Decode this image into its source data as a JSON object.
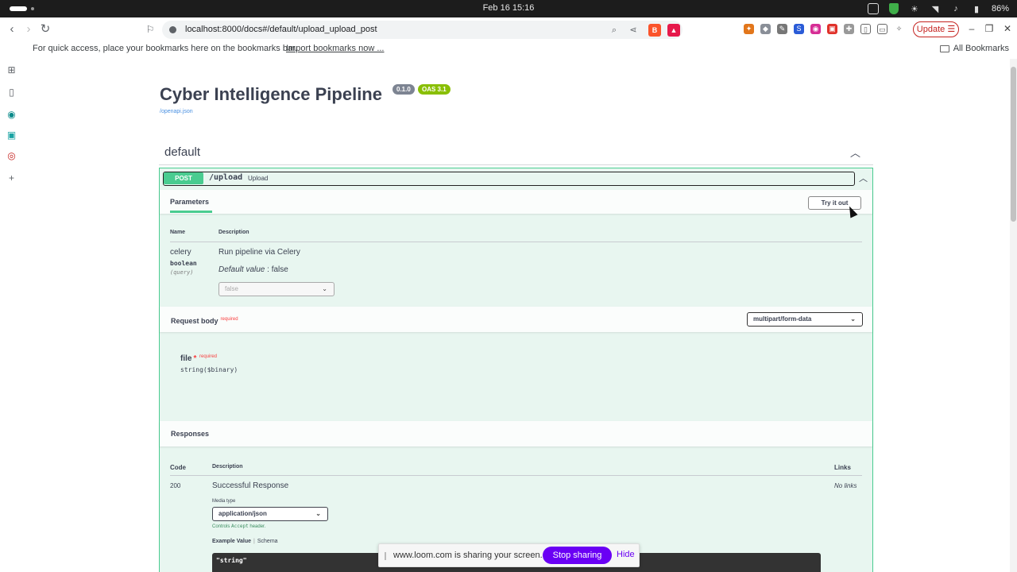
{
  "os": {
    "clock": "Feb 16  15:16",
    "battery": "86%"
  },
  "browser": {
    "url": "localhost:8000/docs#/default/upload_upload_post",
    "update_label": "Update",
    "update_icon": "☰",
    "bookmarks_hint": "For quick access, place your bookmarks here on the bookmarks bar.",
    "import_bookmarks": "Import bookmarks now ...",
    "all_bookmarks": "All Bookmarks"
  },
  "api": {
    "title": "Cyber Intelligence Pipeline",
    "version": "0.1.0",
    "oas": "OAS 3.1",
    "openapi_link": "/openapi.json"
  },
  "tag": {
    "name": "default"
  },
  "operation": {
    "method": "POST",
    "path": "/upload",
    "summary": "Upload",
    "parameters_tab": "Parameters",
    "try_label": "Try it out",
    "param_headers": {
      "name": "Name",
      "description": "Description"
    },
    "param": {
      "name": "celery",
      "type": "boolean",
      "in": "(query)",
      "description": "Run pipeline via Celery",
      "default_label": "Default value",
      "default_value": " : false",
      "select_value": "false"
    },
    "request_body": {
      "title": "Request body",
      "required": "required",
      "content_type": "multipart/form-data",
      "field_name": "file",
      "field_star": "*",
      "field_required": "required",
      "field_type": "string($binary)"
    },
    "responses": {
      "title": "Responses",
      "headers": {
        "code": "Code",
        "description": "Description",
        "links": "Links"
      },
      "code": "200",
      "description": "Successful Response",
      "links": "No links",
      "media_type_label": "Media type",
      "media_type": "application/json",
      "controls_note_pre": "Controls ",
      "controls_note_code": "Accept",
      "controls_note_post": " header.",
      "example_tab": "Example Value",
      "schema_tab": "Schema",
      "example_value": "\"string\""
    }
  },
  "loom": {
    "message": "www.loom.com is sharing your screen.",
    "stop_label": "Stop sharing",
    "hide_label": "Hide"
  },
  "colors": {
    "post_green": "#49cc90",
    "loom_purple": "#6a00f4",
    "required_red": "#f93e3e"
  }
}
